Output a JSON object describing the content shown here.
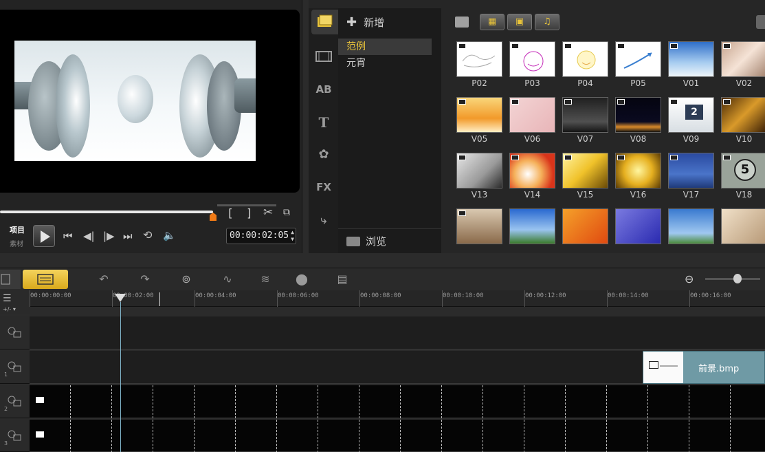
{
  "preview": {
    "mode_project": "项目",
    "mode_clip": "素材",
    "timecode": "00:00:02:05",
    "brackets": [
      "[",
      "]"
    ]
  },
  "library": {
    "add_label": "新增",
    "folders": [
      "范例",
      "元宵"
    ],
    "browse_label": "浏览",
    "thumbnails": [
      "P02",
      "P03",
      "P04",
      "P05",
      "V01",
      "V02",
      "V05",
      "V06",
      "V07",
      "V08",
      "V09",
      "V10",
      "V13",
      "V14",
      "V15",
      "V16",
      "V17",
      "V18"
    ],
    "thumb_v09_digit": "2",
    "thumb_v18_digit": "5"
  },
  "timeline": {
    "ruler_ticks": [
      "00:00:00:00",
      "00:00:02:00",
      "00:00:04:00",
      "00:00:06:00",
      "00:00:08:00",
      "00:00:10:00",
      "00:00:12:00",
      "00:00:14:00",
      "00:00:16:00"
    ],
    "clip_label": "前景.bmp",
    "track_numbers": [
      "",
      "1",
      "2",
      "3"
    ],
    "track_toggle": "+/- ▾"
  },
  "colors": {
    "accent_yellow": "#e8c33a",
    "scrub_orange": "#f07a16",
    "clip_teal": "#6f9aa5"
  }
}
